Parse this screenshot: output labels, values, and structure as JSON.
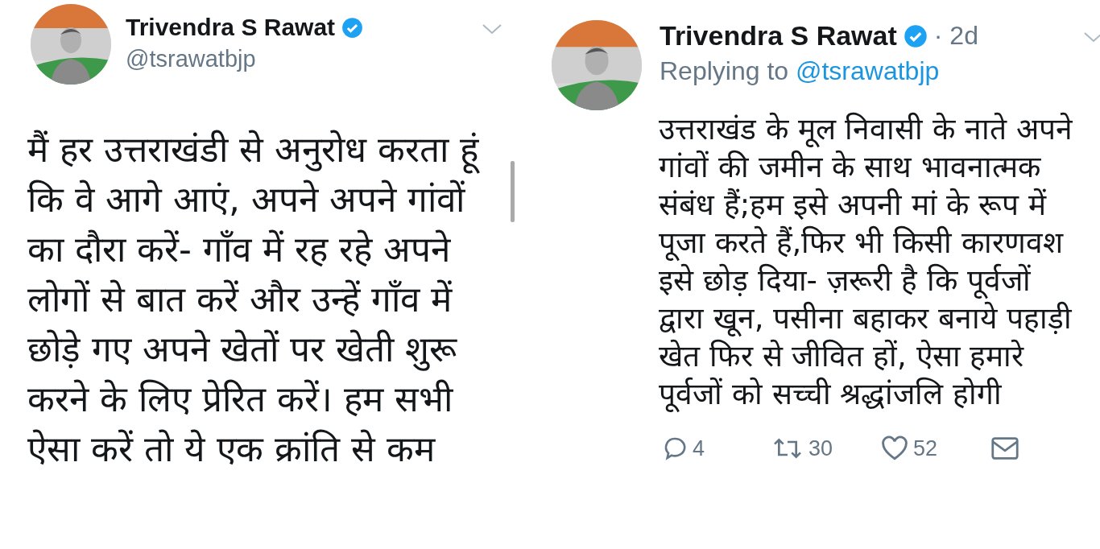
{
  "tweets": [
    {
      "name": "Trivendra S Rawat",
      "verified": true,
      "handle": "@tsrawatbjp",
      "kind": "detail",
      "lines": [
        "मैं हर उत्तराखंडी से अनुरोध करता हूं",
        "कि वे आगे आएं, अपने अपने गांवों",
        "का दौरा करें- गाँव में रह रहे अपने",
        "लोगों से बात करें और उन्हें गाँव में",
        "छोड़े गए अपने खेतों पर खेती शुरू",
        "करने के लिए प्रेरित करें। हम सभी",
        "ऐसा करें तो ये एक क्रांति से कम"
      ]
    },
    {
      "name": "Trivendra S Rawat",
      "verified": true,
      "time": "· 2d",
      "replying_label": "Replying to",
      "replying_handle": "@tsrawatbjp",
      "kind": "reply",
      "lines": [
        "उत्तराखंड के मूल निवासी के नाते अपने",
        "गांवों की जमीन के साथ भावनात्मक",
        "संबंध हैं;हम इसे अपनी मां के रूप में",
        "पूजा करते हैं,फिर भी किसी कारणवश",
        "इसे छोड़ दिया- ज़रूरी है कि पूर्वजों",
        "द्वारा खून, पसीना बहाकर बनाये पहाड़ी",
        "खेत फिर से जीवित हों, ऐसा हमारे",
        "पूर्वजों को सच्ची श्रद्धांजलि होगी"
      ],
      "actions": [
        {
          "kind": "reply",
          "count": "4"
        },
        {
          "kind": "retweet",
          "count": "30"
        },
        {
          "kind": "like",
          "count": "52"
        },
        {
          "kind": "message"
        }
      ]
    }
  ]
}
